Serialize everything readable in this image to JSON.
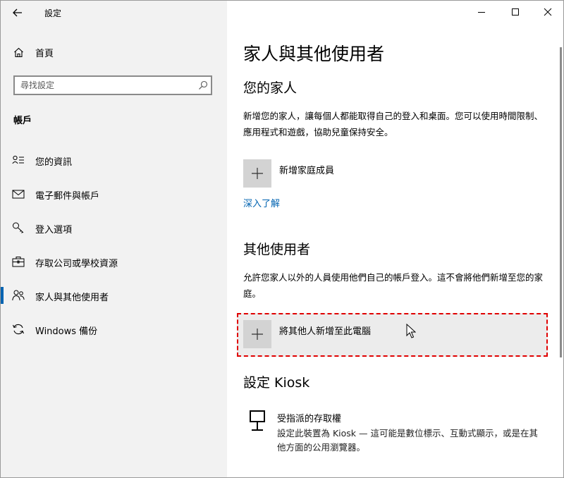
{
  "app": {
    "title": "設定"
  },
  "sidebar": {
    "home_label": "首頁",
    "search_placeholder": "尋找設定",
    "section_title": "帳戶",
    "items": [
      {
        "label": "您的資訊",
        "icon": "person-info-icon"
      },
      {
        "label": "電子郵件與帳戶",
        "icon": "mail-icon"
      },
      {
        "label": "登入選項",
        "icon": "key-icon"
      },
      {
        "label": "存取公司或學校資源",
        "icon": "briefcase-icon"
      },
      {
        "label": "家人與其他使用者",
        "icon": "people-icon",
        "active": true
      },
      {
        "label": "Windows 備份",
        "icon": "sync-icon"
      }
    ]
  },
  "main": {
    "title": "家人與其他使用者",
    "family": {
      "heading": "您的家人",
      "description": "新增您的家人，讓每個人都能取得自己的登入和桌面。您可以使用時間限制、應用程式和遊戲，協助兒童保持安全。",
      "add_label": "新增家庭成員",
      "learn_more": "深入了解"
    },
    "others": {
      "heading": "其他使用者",
      "description": "允許您家人以外的人員使用他們自己的帳戶登入。這不會將他們新增至您的家庭。",
      "add_label": "將其他人新增至此電腦"
    },
    "kiosk": {
      "heading": "設定 Kiosk",
      "item_title": "受指派的存取權",
      "item_desc": "設定此裝置為 Kiosk — 這可能是數位標示、互動式顯示，或是在其他方面的公用瀏覽器。"
    }
  },
  "colors": {
    "accent": "#0063b1",
    "highlight": "#e00000",
    "sidebar_bg": "#f2f2f2"
  }
}
